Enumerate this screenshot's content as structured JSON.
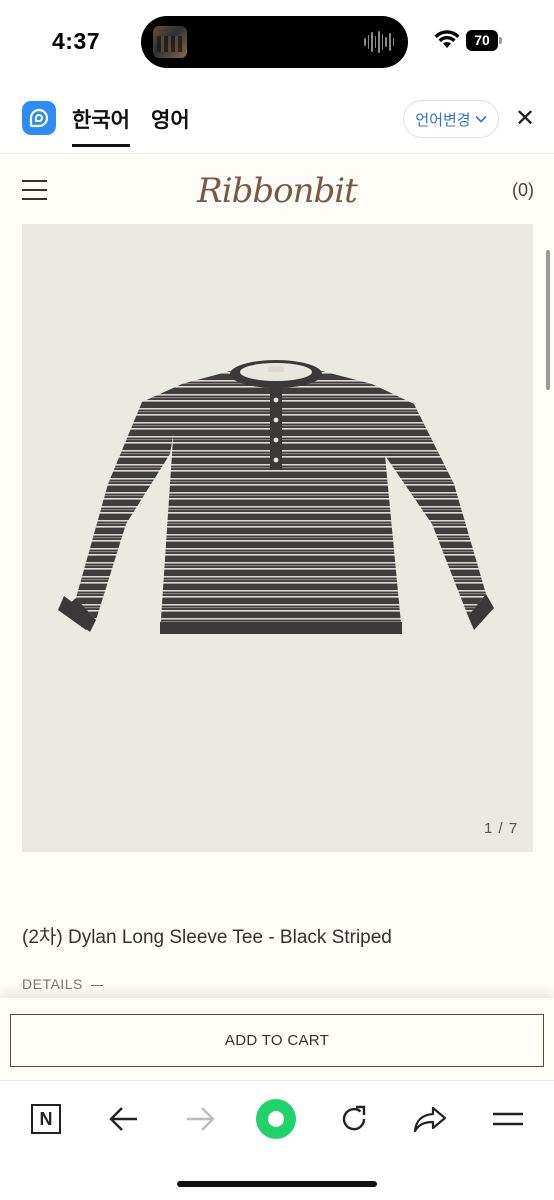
{
  "status_bar": {
    "time": "4:37",
    "battery": "70"
  },
  "translate_bar": {
    "tab_korean": "한국어",
    "tab_english": "영어",
    "change_language": "언어변경",
    "close_symbol": "✕"
  },
  "site": {
    "logo": "Ribbonbit",
    "cart_count": "(0)"
  },
  "product": {
    "image_counter": "1 / 7",
    "title": "(2차) Dylan Long Sleeve Tee - Black Striped",
    "details_label": "DETAILS",
    "add_to_cart": "ADD TO CART"
  },
  "toolbar": {
    "n_label": "N",
    "icons": [
      "naver-icon",
      "back-arrow-icon",
      "forward-arrow-icon",
      "green-dot-icon",
      "reload-icon",
      "share-icon",
      "menu-icon"
    ]
  },
  "colors": {
    "page_bg": "#fdfcf6",
    "logo": "#7a5a44",
    "accent_blue": "#2f74d6",
    "green_button": "#1fd26a",
    "image_bg": "#eaeae3"
  }
}
